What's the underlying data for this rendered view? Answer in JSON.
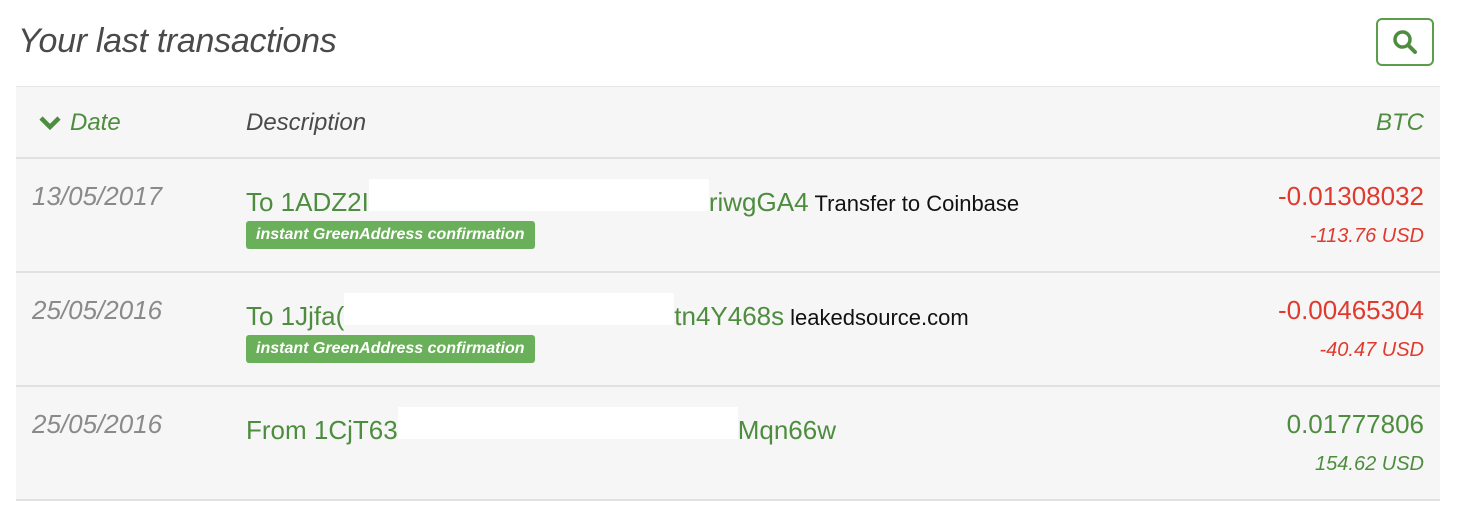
{
  "header": {
    "title": "Your last transactions",
    "search_icon": "search-icon"
  },
  "table": {
    "columns": {
      "date": "Date",
      "description": "Description",
      "btc": "BTC"
    },
    "sort_icon": "chevron-down-icon",
    "rows": [
      {
        "date": "13/05/2017",
        "addr_start": "To 1ADZ2I",
        "addr_end": "riwgGA4",
        "memo": "Transfer to Coinbase",
        "badge": "instant GreenAddress confirmation",
        "btc": "-0.01308032",
        "usd": "-113.76 USD",
        "sign": "negative"
      },
      {
        "date": "25/05/2016",
        "addr_start": "To 1Jjfa(",
        "addr_end": "tn4Y468s",
        "memo": "leakedsource.com",
        "badge": "instant GreenAddress confirmation",
        "btc": "-0.00465304",
        "usd": "-40.47 USD",
        "sign": "negative"
      },
      {
        "date": "25/05/2016",
        "addr_start": "From 1CjT63",
        "addr_end": "Mqn66w",
        "memo": "",
        "badge": "",
        "btc": "0.01777806",
        "usd": "154.62 USD",
        "sign": "positive"
      }
    ]
  },
  "colors": {
    "accent": "#4e8d3f",
    "negative": "#e03a2e",
    "badge": "#6ab05a"
  }
}
